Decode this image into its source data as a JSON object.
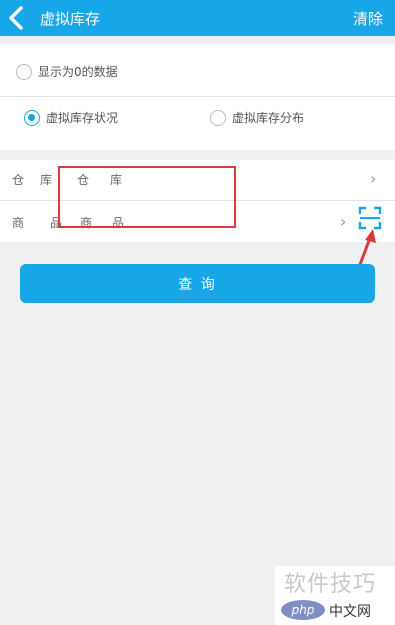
{
  "header": {
    "title": "虚拟库存",
    "action_label": "清除"
  },
  "options": {
    "show_zero_label": "显示为0的数据",
    "mode_status_label": "虚拟库存状况",
    "mode_distribution_label": "虚拟库存分布",
    "selected_mode": "虚拟库存状况"
  },
  "form": {
    "warehouse_row": {
      "label1": "仓",
      "label2": "库",
      "overlay_label1": "仓",
      "overlay_label2": "库"
    },
    "product_row": {
      "label1": "商",
      "label2": "品",
      "overlay_label1": "商",
      "overlay_label2": "品"
    }
  },
  "query_button": {
    "label": "查    询"
  },
  "watermark": {
    "line1": "软件技巧",
    "logo": "php",
    "line2": "中文网"
  },
  "colors": {
    "primary": "#17a6e8",
    "highlight": "#d93a3a"
  }
}
